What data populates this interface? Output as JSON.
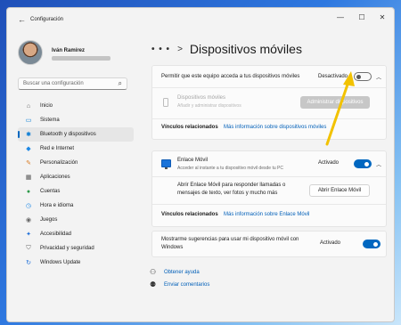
{
  "window": {
    "title": "Configuración"
  },
  "profile": {
    "name": "Iván Ramírez"
  },
  "search": {
    "placeholder": "Buscar una configuración"
  },
  "nav": [
    {
      "label": "Inicio",
      "icon": "home-icon",
      "glyph": "⌂",
      "color": "#555555"
    },
    {
      "label": "Sistema",
      "icon": "system-icon",
      "glyph": "▭",
      "color": "#0078d4"
    },
    {
      "label": "Bluetooth y dispositivos",
      "icon": "bluetooth-icon",
      "glyph": "✱",
      "color": "#0078d4"
    },
    {
      "label": "Red e Internet",
      "icon": "network-icon",
      "glyph": "◆",
      "color": "#1e88e5"
    },
    {
      "label": "Personalización",
      "icon": "brush-icon",
      "glyph": "✎",
      "color": "#d97a20"
    },
    {
      "label": "Aplicaciones",
      "icon": "apps-icon",
      "glyph": "▦",
      "color": "#555555"
    },
    {
      "label": "Cuentas",
      "icon": "accounts-icon",
      "glyph": "●",
      "color": "#2e9a4a"
    },
    {
      "label": "Hora e idioma",
      "icon": "clock-icon",
      "glyph": "◷",
      "color": "#1e88e5"
    },
    {
      "label": "Juegos",
      "icon": "gamepad-icon",
      "glyph": "◉",
      "color": "#666666"
    },
    {
      "label": "Accesibilidad",
      "icon": "accessibility-icon",
      "glyph": "✦",
      "color": "#1e6fd9"
    },
    {
      "label": "Privacidad y seguridad",
      "icon": "shield-icon",
      "glyph": "⛉",
      "color": "#666666"
    },
    {
      "label": "Windows Update",
      "icon": "update-icon",
      "glyph": "↻",
      "color": "#1e6fd9"
    }
  ],
  "nav_active_index": 2,
  "breadcrumb": {
    "ellipsis": "• • •",
    "separator": ">",
    "title": "Dispositivos móviles"
  },
  "card1": {
    "permit_label": "Permitir que este equipo acceda a tus dispositivos móviles",
    "permit_state": "Desactivado",
    "permit_on": false,
    "devices_title": "Dispositivos móviles",
    "devices_subtitle": "Añadir y administrar dispositivos",
    "manage_button": "Administrar dispositivos",
    "related_label": "Vínculos relacionados",
    "related_link": "Más información sobre dispositivos móviles"
  },
  "card2": {
    "title": "Enlace Móvil",
    "subtitle": "Acceder al instante a tu dispositivo móvil desde tu PC",
    "state": "Activado",
    "on": true,
    "desc_line1": "Abrir Enlace Móvil para responder llamadas o",
    "desc_line2": "mensajes de texto, ver fotos y mucho más",
    "open_button": "Abrir Enlace Móvil",
    "related_label": "Vínculos relacionados",
    "related_link": "Más información sobre Enlace Móvil"
  },
  "card3": {
    "line1": "Mostrarme sugerencias para usar mi dispositivo móvil con",
    "line2": "Windows",
    "state": "Activado",
    "on": true
  },
  "help": {
    "get_help": "Obtener ayuda",
    "feedback": "Enviar comentarios"
  },
  "colors": {
    "accent": "#0067c0",
    "annotation_arrow": "#f2c200"
  }
}
